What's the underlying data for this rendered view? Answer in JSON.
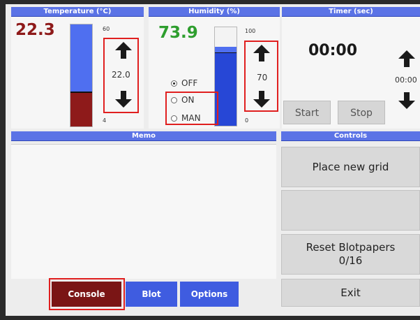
{
  "temperature": {
    "header": "Temperature (°C)",
    "value": "22.3",
    "scale_max": "60",
    "scale_min": "4",
    "setpoint": "22.0",
    "level_fraction": 0.33
  },
  "humidity": {
    "header": "Humidity (%)",
    "value": "73.9",
    "scale_max": "100",
    "scale_min": "0",
    "setpoint": "70",
    "level_fraction": 0.74,
    "modes": [
      "OFF",
      "ON",
      "MAN"
    ],
    "selected_mode": "OFF"
  },
  "timer": {
    "header": "Timer (sec)",
    "display": "00:00",
    "setpoint": "00:00",
    "start_label": "Start",
    "stop_label": "Stop"
  },
  "memo": {
    "header": "Memo"
  },
  "controls": {
    "header": "Controls",
    "place_grid_label": "Place new grid",
    "reset_label": "Reset Blotpapers",
    "reset_count": "0/16",
    "exit_label": "Exit"
  },
  "tabs": [
    {
      "label": "Console",
      "color": "#7a1515"
    },
    {
      "label": "Blot",
      "color": "#3f5ce0"
    },
    {
      "label": "Options",
      "color": "#3f5ce0"
    }
  ],
  "colors": {
    "temperature_value": "#8e1a1a",
    "humidity_value": "#2e9e2e",
    "header_blue": "#5b73e6",
    "annotation_red": "#e01f1f"
  }
}
